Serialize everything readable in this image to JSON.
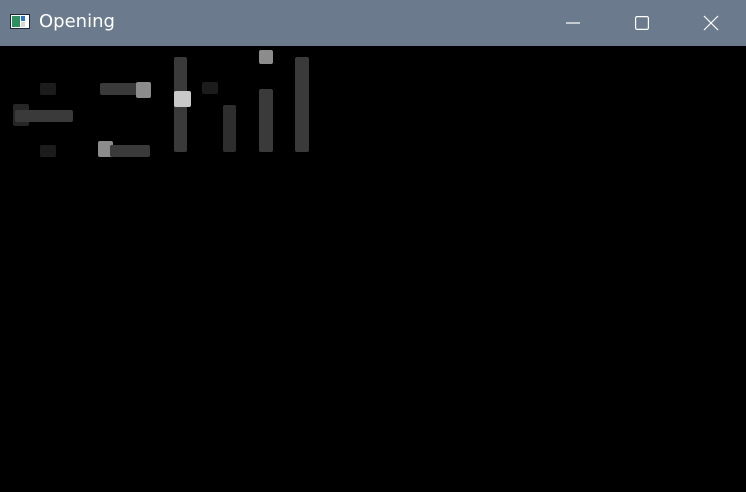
{
  "window": {
    "title": "Opening",
    "icon": "app-window-icon",
    "controls": [
      "minimize-icon",
      "maximize-icon",
      "close-icon"
    ]
  },
  "colors": {
    "titlebar": "#6b7a8c",
    "canvas": "#000000",
    "glyph_dark": "#1c1c1c",
    "glyph_mid": "#3a3a3a",
    "glyph_light": "#8c8c8c",
    "glyph_bright": "#c9c9c9"
  }
}
